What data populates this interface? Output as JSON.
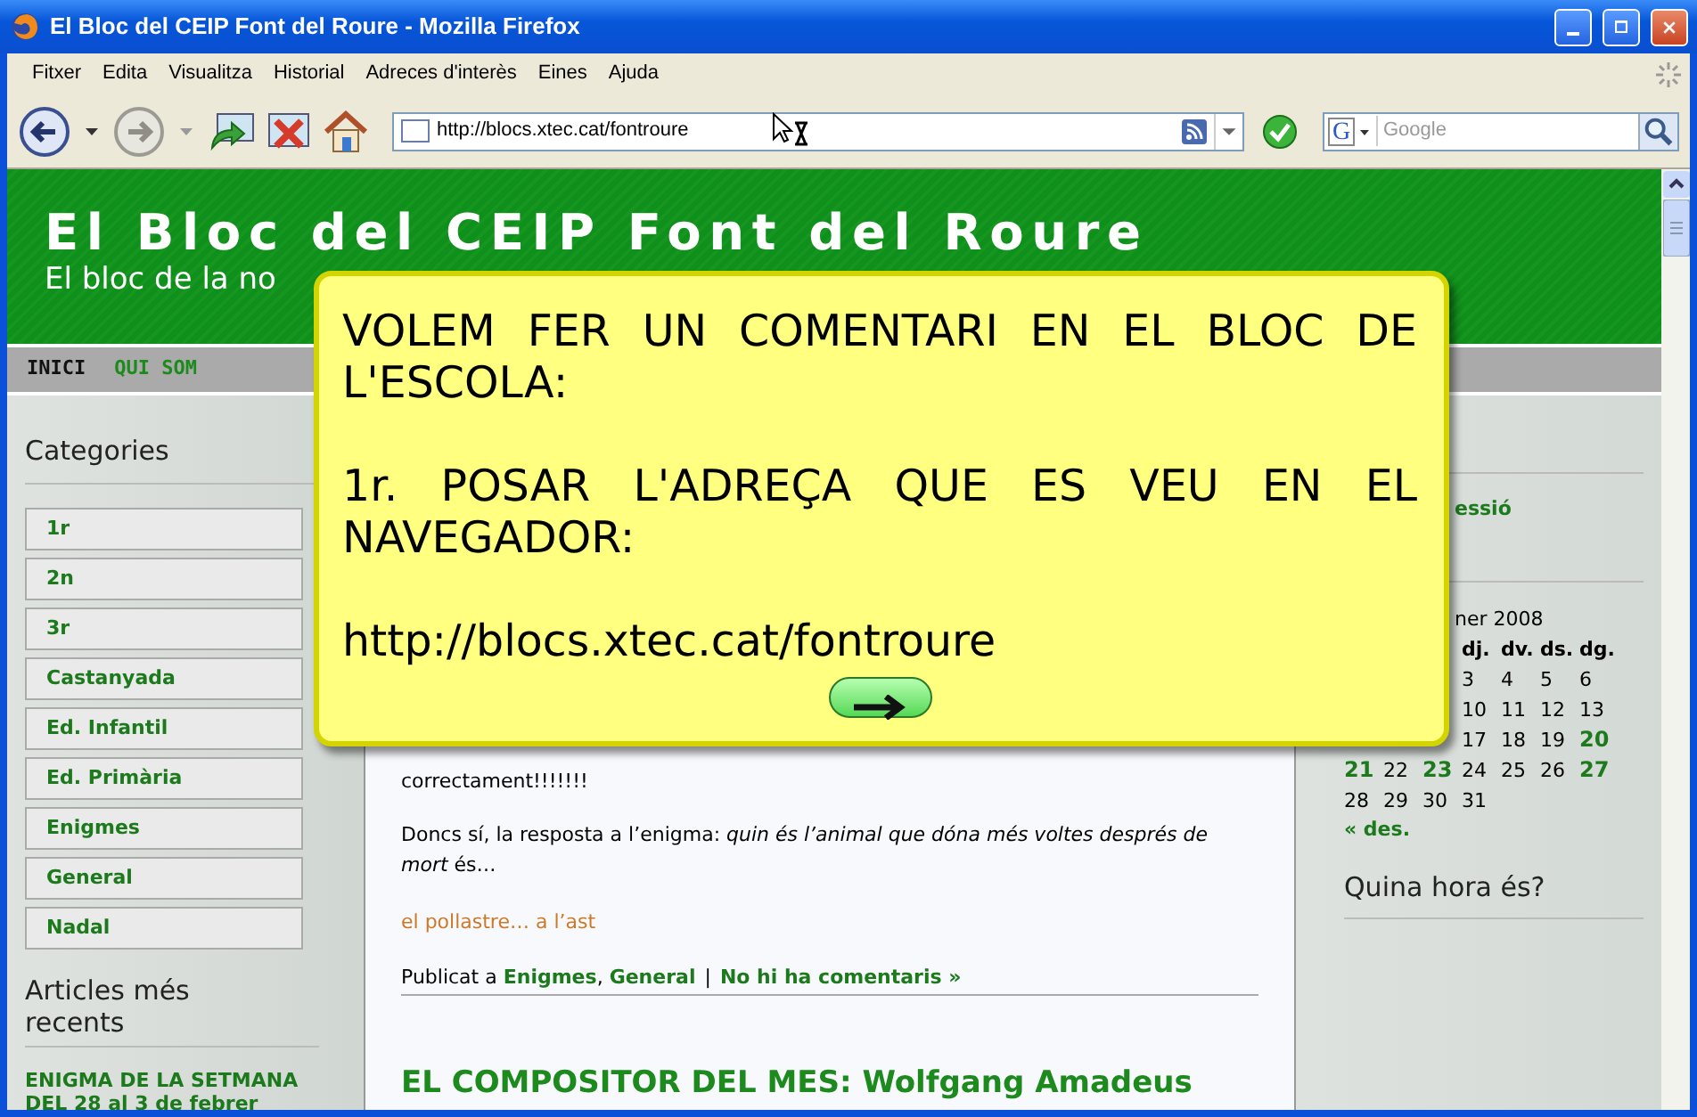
{
  "window": {
    "title": "El Bloc del CEIP Font del Roure - Mozilla Firefox"
  },
  "menu": [
    "Fitxer",
    "Edita",
    "Visualitza",
    "Historial",
    "Adreces d'interès",
    "Eines",
    "Ajuda"
  ],
  "toolbar": {
    "buttons": [
      {
        "kind": "back",
        "disabled": false
      },
      {
        "kind": "forward",
        "disabled": true
      },
      {
        "kind": "reload",
        "disabled": false
      },
      {
        "kind": "stop",
        "disabled": false
      },
      {
        "kind": "home",
        "disabled": false
      }
    ],
    "url": "http://blocs.xtec.cat/fontroure",
    "search_engine_letter": "G",
    "search_placeholder": "Google"
  },
  "blog": {
    "title": "El Bloc del CEIP Font del Roure",
    "subtitle": "El bloc de la no",
    "nav": [
      {
        "label": "INICI",
        "selected": true
      },
      {
        "label": "QUI SOM",
        "selected": false
      }
    ],
    "left": {
      "categories_title": "Categories",
      "categories": [
        "1r",
        "2n",
        "3r",
        "Castanyada",
        "Ed. Infantil",
        "Ed. Primària",
        "Enigmes",
        "General",
        "Nadal"
      ],
      "recent_title": "Articles més recents",
      "recent": [
        "ENIGMA DE LA SETMANA DEL 28 al 3 de febrer"
      ]
    },
    "post": {
      "line": "correctament!!!!!!!",
      "answer": "Doncs sí, la resposta a l’enigma: *quin és l’animal que dóna més voltes després de mort*  és…",
      "reveal": "el pollastre… a l’ast",
      "meta_prefix": "Publicat a",
      "meta_links": [
        "Enigmes",
        "General"
      ],
      "meta_comma": ",",
      "meta_divider": "|",
      "comments": "No hi ha comentaris »"
    },
    "next_post_title": "EL COMPOSITOR DEL MES: Wolfgang Amadeus",
    "right": {
      "login_fragment": "essió",
      "calendar_caption": "ner 2008",
      "calendar_head": {
        "kind": "covered",
        "cells": [
          "dj.",
          "dv.",
          "ds.",
          "dg."
        ]
      },
      "calendar_weeks": [
        {
          "kind": "covered",
          "cells": [
            {
              "day": "3",
              "linked": false
            },
            {
              "day": "4",
              "linked": false
            },
            {
              "day": "5",
              "linked": false
            },
            {
              "day": "6",
              "linked": false
            }
          ]
        },
        {
          "kind": "covered",
          "cells": [
            {
              "day": "10",
              "linked": false
            },
            {
              "day": "11",
              "linked": false
            },
            {
              "day": "12",
              "linked": false
            },
            {
              "day": "13",
              "linked": false
            }
          ]
        },
        {
          "kind": "covered",
          "cells": [
            {
              "day": "17",
              "linked": false
            },
            {
              "day": "18",
              "linked": false
            },
            {
              "day": "19",
              "linked": false
            },
            {
              "day": "20",
              "linked": true
            }
          ]
        },
        {
          "kind": "full",
          "cells": [
            {
              "day": "21",
              "linked": true
            },
            {
              "day": "22",
              "linked": false
            },
            {
              "day": "23",
              "linked": true
            },
            {
              "day": "24",
              "linked": false
            },
            {
              "day": "25",
              "linked": false
            },
            {
              "day": "26",
              "linked": false
            },
            {
              "day": "27",
              "linked": true
            }
          ]
        },
        {
          "kind": "full",
          "cells": [
            {
              "day": "28",
              "linked": false
            },
            {
              "day": "29",
              "linked": false
            },
            {
              "day": "30",
              "linked": false
            },
            {
              "day": "31",
              "linked": false
            }
          ]
        }
      ],
      "calendar_prev": "« des.",
      "clock_title": "Quina hora és?"
    }
  },
  "overlay": {
    "paragraphs": [
      "VOLEM FER UN COMENTARI EN EL BLOC DE L'ESCOLA:",
      "1r. POSAR L'ADREÇA QUE ES VEU EN EL NAVEGADOR:"
    ],
    "url": "http://blocs.xtec.cat/fontroure"
  }
}
